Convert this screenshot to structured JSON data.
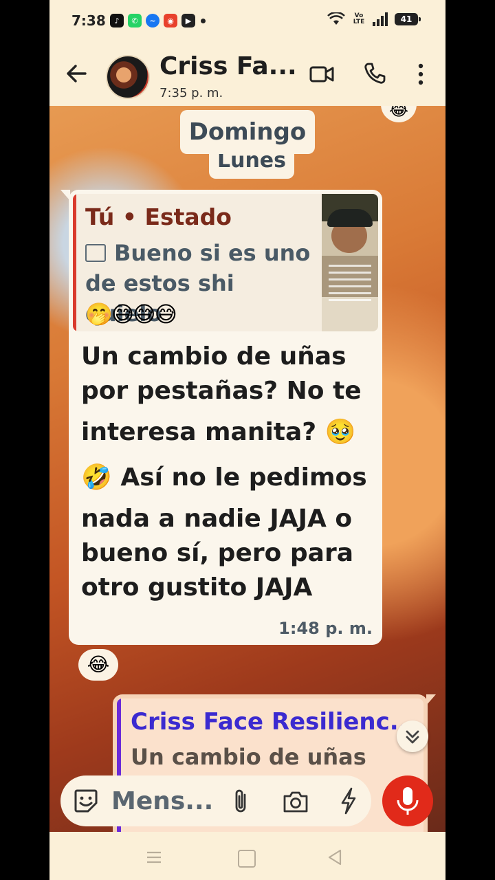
{
  "status_bar": {
    "time": "7:38",
    "volte": "Vo LTE",
    "battery": "41",
    "notification_icons": [
      "tiktok-icon",
      "whatsapp-icon",
      "messenger-icon",
      "app-icon",
      "youtube-icon"
    ]
  },
  "header": {
    "contact_name": "Criss Fa...",
    "last_seen": "7:35 p. m."
  },
  "chat": {
    "day_chip_primary": "Domingo",
    "day_chip_secondary": "Lunes",
    "corner_emoji": "😂",
    "incoming": {
      "quote_author": "Tú • Estado",
      "quote_text": "Bueno si es uno de estos shi quielo",
      "quote_emojis": "🤭😅😅😅",
      "line1": "Un cambio de uñas",
      "line2": "por pestañas? No te",
      "line3": "interesa manita? 🥹",
      "line4": "🤣 Así no le pedimos",
      "line5": "nada a nadie JAJA o",
      "line6": "bueno sí, pero para",
      "line7": "otro gustito JAJA",
      "time": "1:48 p. m.",
      "reaction": "😂"
    },
    "outgoing": {
      "quote_author": "Criss Face Resilienc...",
      "quote_text": "Un cambio de uñas"
    }
  },
  "input_bar": {
    "placeholder": "Mens..."
  },
  "colors": {
    "background": "#fbf0d8",
    "mic": "#e12a1a",
    "quote_bar_in": "#d93a2c",
    "quote_bar_out": "#6b2ad8"
  }
}
